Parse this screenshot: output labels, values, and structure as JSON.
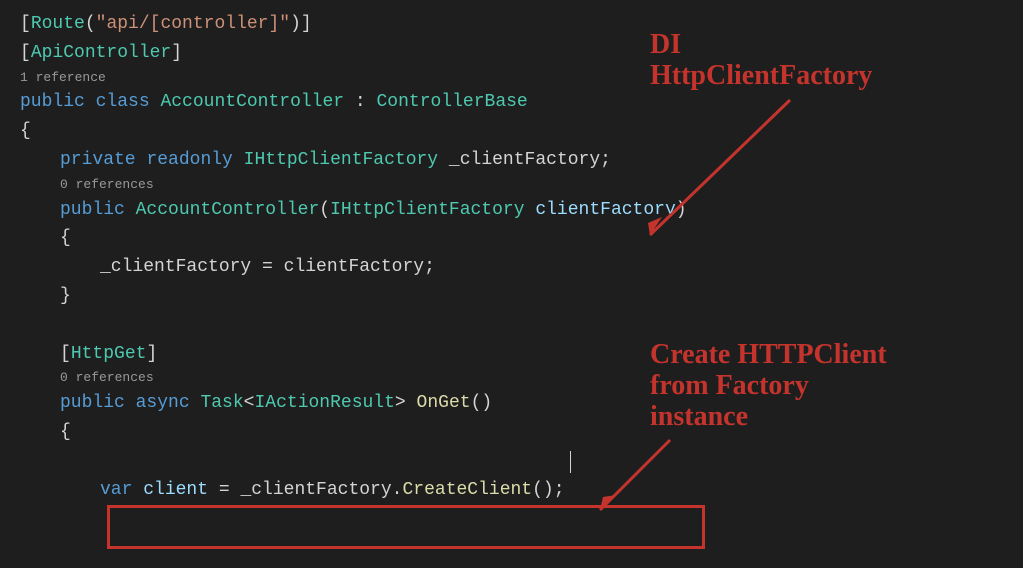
{
  "code": {
    "route_attr_open": "[",
    "route_type": "Route",
    "route_paren_open": "(",
    "route_string": "\"api/[controller]\"",
    "route_paren_close": ")",
    "route_attr_close": "]",
    "apicontroller_open": "[",
    "apicontroller_type": "ApiController",
    "apicontroller_close": "]",
    "codelens1": "1 reference",
    "public": "public",
    "class": "class",
    "accountcontroller": "AccountController",
    "colon": " : ",
    "controllerbase": "ControllerBase",
    "brace_open": "{",
    "private": "private",
    "readonly": "readonly",
    "ihttpclientfactory": "IHttpClientFactory",
    "field": "_clientFactory",
    "semicolon": ";",
    "codelens2": "0 references",
    "ctor_param_open": "(",
    "ctor_param_type": "IHttpClientFactory",
    "ctor_param_name": "clientFactory",
    "ctor_param_close": ")",
    "brace_open2": "{",
    "assign_left": "_clientFactory",
    "assign_eq": " = ",
    "assign_right": "clientFactory",
    "brace_close2": "}",
    "httpget_open": "[",
    "httpget_type": "HttpGet",
    "httpget_close": "]",
    "codelens3": "0 references",
    "async": "async",
    "task": "Task",
    "lt": "<",
    "iactionresult": "IActionResult",
    "gt": ">",
    "onget": "OnGet",
    "empty_parens": "()",
    "brace_open3": "{",
    "var": "var",
    "client": "client",
    "eq2": " = ",
    "factory_field": "_clientFactory",
    "dot": ".",
    "createclient": "CreateClient",
    "call_parens": "()",
    "semi2": ";"
  },
  "annotations": {
    "anno1_line1": "DI",
    "anno1_line2": "HttpClientFactory",
    "anno2_line1": "Create HTTPClient",
    "anno2_line2": "from Factory",
    "anno2_line3": "instance"
  }
}
